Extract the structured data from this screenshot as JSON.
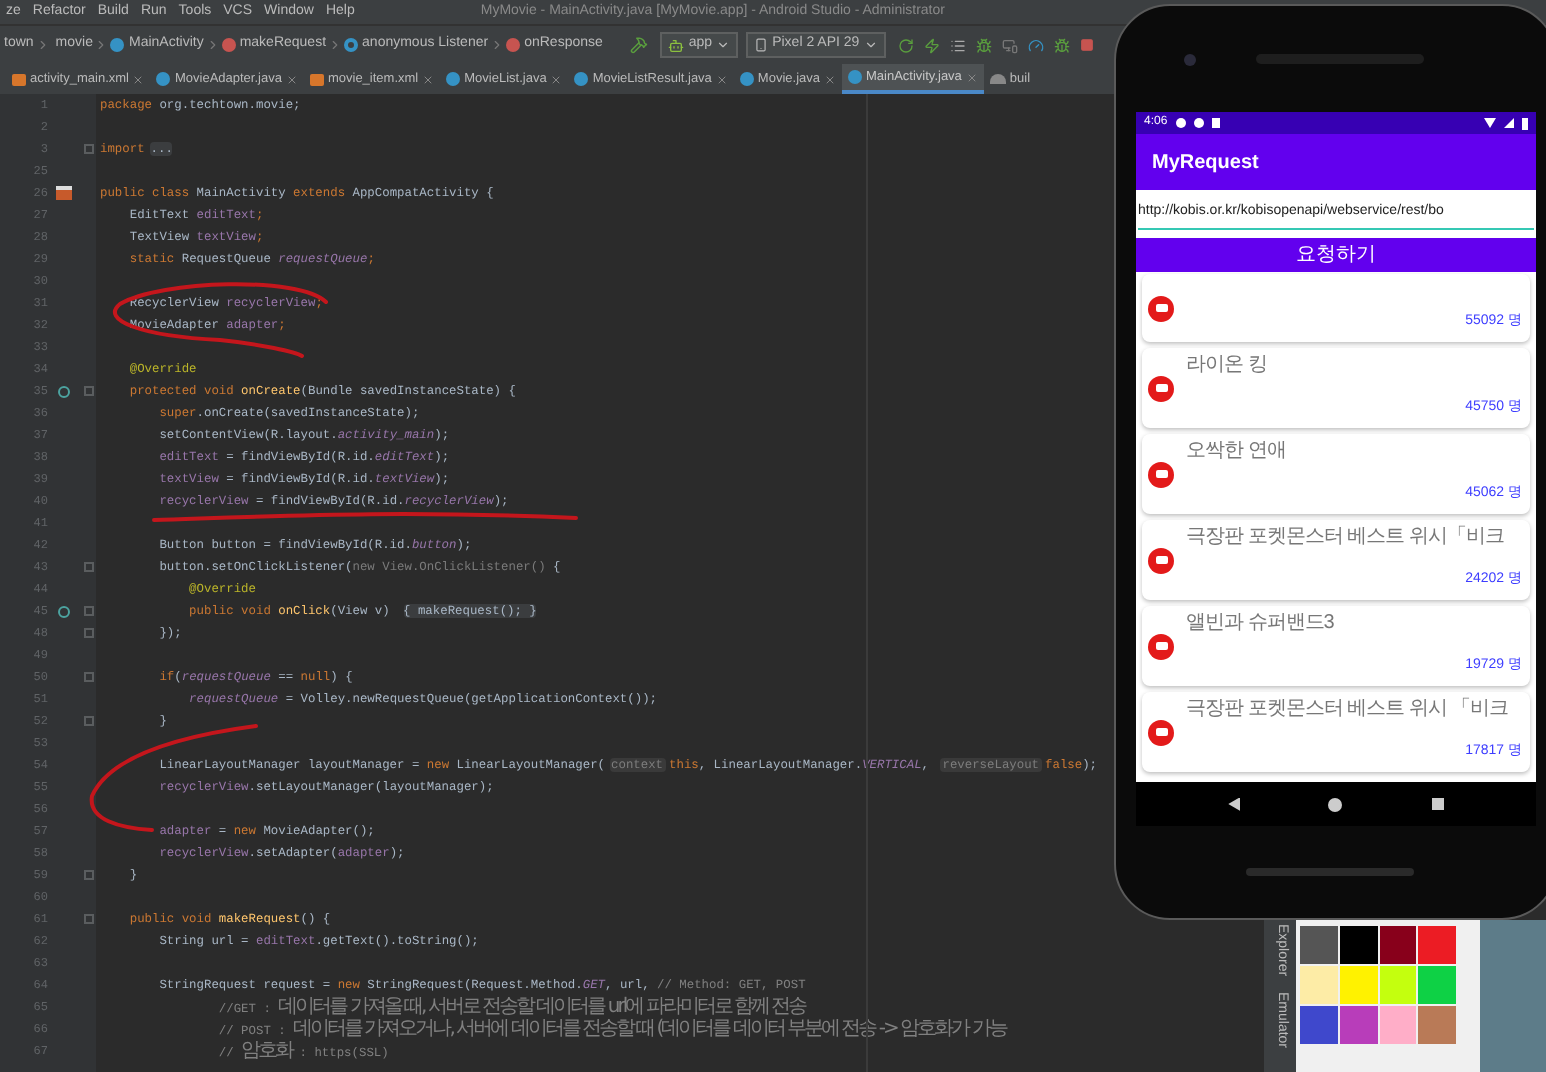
{
  "window": {
    "title": "MyMovie - MainActivity.java [MyMovie.app] - Android Studio - Administrator"
  },
  "menu": [
    "ze",
    "Refactor",
    "Build",
    "Run",
    "Tools",
    "VCS",
    "Window",
    "Help"
  ],
  "breadcrumbs": [
    {
      "label": "town",
      "kind": "folder"
    },
    {
      "label": "movie",
      "kind": "folder"
    },
    {
      "label": "MainActivity",
      "kind": "class"
    },
    {
      "label": "makeRequest",
      "kind": "method"
    },
    {
      "label": "anonymous Listener",
      "kind": "anonymous"
    },
    {
      "label": "onResponse",
      "kind": "method"
    }
  ],
  "run_config": {
    "module": "app",
    "device": "Pixel 2 API 29"
  },
  "tabs": [
    {
      "label": "activity_main.xml",
      "kind": "xml",
      "selected": false
    },
    {
      "label": "MovieAdapter.java",
      "kind": "java",
      "selected": false
    },
    {
      "label": "movie_item.xml",
      "kind": "xml",
      "selected": false
    },
    {
      "label": "MovieList.java",
      "kind": "java",
      "selected": false
    },
    {
      "label": "MovieListResult.java",
      "kind": "java",
      "selected": false
    },
    {
      "label": "Movie.java",
      "kind": "java",
      "selected": false
    },
    {
      "label": "MainActivity.java",
      "kind": "java",
      "selected": true
    },
    {
      "label": "buil",
      "kind": "gradle",
      "selected": false
    }
  ],
  "editor": {
    "lines": [
      {
        "number": "1",
        "fold": false,
        "segments": [
          {
            "kind": "kw",
            "text": "package"
          },
          {
            "kind": "p",
            "text": " org.techtown.movie;"
          }
        ]
      },
      {
        "number": "2",
        "fold": false
      },
      {
        "number": "3",
        "fold": true,
        "segments": [
          {
            "kind": "kw",
            "text": "import"
          },
          {
            "kind": "fold",
            "text": "..."
          }
        ]
      },
      {
        "number": "25",
        "fold": false
      },
      {
        "number": "26",
        "fold": false,
        "kind": "class",
        "segments": [
          {
            "kind": "kw",
            "text": "public class"
          },
          {
            "kind": "p",
            "text": " MainActivity "
          },
          {
            "kind": "kw",
            "text": "extends"
          },
          {
            "kind": "p",
            "text": " AppCompatActivity {"
          }
        ]
      },
      {
        "number": "27",
        "fold": false,
        "segments": [
          {
            "kind": "p",
            "text": "    EditText "
          },
          {
            "kind": "f",
            "text": "editText"
          },
          {
            "kind": "kw",
            "text": ";"
          }
        ]
      },
      {
        "number": "28",
        "fold": false,
        "segments": [
          {
            "kind": "p",
            "text": "    TextView "
          },
          {
            "kind": "f",
            "text": "textView"
          },
          {
            "kind": "kw",
            "text": ";"
          }
        ]
      },
      {
        "number": "29",
        "fold": false,
        "segments": [
          {
            "kind": "kw",
            "text": "    static"
          },
          {
            "kind": "p",
            "text": " RequestQueue "
          },
          {
            "kind": "fi",
            "text": "requestQueue"
          },
          {
            "kind": "kw",
            "text": ";"
          }
        ]
      },
      {
        "number": "30",
        "fold": false
      },
      {
        "number": "31",
        "fold": false,
        "segments": [
          {
            "kind": "p",
            "text": "    RecyclerView "
          },
          {
            "kind": "f",
            "text": "recyclerView"
          },
          {
            "kind": "kw",
            "text": ";"
          }
        ]
      },
      {
        "number": "32",
        "fold": false,
        "segments": [
          {
            "kind": "p",
            "text": "    MovieAdapter "
          },
          {
            "kind": "f",
            "text": "adapter"
          },
          {
            "kind": "kw",
            "text": ";"
          }
        ]
      },
      {
        "number": "33",
        "fold": false
      },
      {
        "number": "34",
        "fold": false,
        "segments": [
          {
            "kind": "a",
            "text": "    @Override"
          }
        ]
      },
      {
        "number": "35",
        "fold": true,
        "kind": "override",
        "segments": [
          {
            "kind": "kw",
            "text": "    protected void"
          },
          {
            "kind": "m",
            "text": " onCreate"
          },
          {
            "kind": "p",
            "text": "(Bundle savedInstanceState) {"
          }
        ]
      },
      {
        "number": "36",
        "fold": false,
        "segments": [
          {
            "kind": "kw",
            "text": "        super"
          },
          {
            "kind": "p",
            "text": ".onCreate(savedInstanceState);"
          }
        ]
      },
      {
        "number": "37",
        "fold": false,
        "segments": [
          {
            "kind": "p",
            "text": "        setContentView(R.layout."
          },
          {
            "kind": "fi",
            "text": "activity_main"
          },
          {
            "kind": "p",
            "text": ");"
          }
        ]
      },
      {
        "number": "38",
        "fold": false,
        "segments": [
          {
            "kind": "f",
            "text": "        editText"
          },
          {
            "kind": "p",
            "text": " = findViewById(R.id."
          },
          {
            "kind": "fi",
            "text": "editText"
          },
          {
            "kind": "p",
            "text": ");"
          }
        ]
      },
      {
        "number": "39",
        "fold": false,
        "segments": [
          {
            "kind": "f",
            "text": "        textView"
          },
          {
            "kind": "p",
            "text": " = findViewById(R.id."
          },
          {
            "kind": "fi",
            "text": "textView"
          },
          {
            "kind": "p",
            "text": ");"
          }
        ]
      },
      {
        "number": "40",
        "fold": false,
        "segments": [
          {
            "kind": "f",
            "text": "        recyclerView"
          },
          {
            "kind": "p",
            "text": " = findViewById(R.id."
          },
          {
            "kind": "fi",
            "text": "recyclerView"
          },
          {
            "kind": "p",
            "text": ");"
          }
        ]
      },
      {
        "number": "41",
        "fold": false
      },
      {
        "number": "42",
        "fold": false,
        "segments": [
          {
            "kind": "p",
            "text": "        Button button = findViewById(R.id."
          },
          {
            "kind": "fi",
            "text": "button"
          },
          {
            "kind": "p",
            "text": ");"
          }
        ]
      },
      {
        "number": "43",
        "fold": true,
        "segments": [
          {
            "kind": "p",
            "text": "        button.setOnClickListener("
          },
          {
            "kind": "dim",
            "text": "new View.OnClickListener()"
          },
          {
            "kind": "p",
            "text": " {"
          }
        ]
      },
      {
        "number": "44",
        "fold": false,
        "segments": [
          {
            "kind": "a",
            "text": "            @Override"
          }
        ]
      },
      {
        "number": "45",
        "fold": true,
        "kind": "override",
        "segments": [
          {
            "kind": "kw",
            "text": "            public void"
          },
          {
            "kind": "m",
            "text": " onClick"
          },
          {
            "kind": "p",
            "text": "(View v) "
          },
          {
            "kind": "fold",
            "text": "{ makeRequest(); }"
          }
        ]
      },
      {
        "number": "48",
        "fold": true,
        "segments": [
          {
            "kind": "p",
            "text": "        });"
          }
        ]
      },
      {
        "number": "49",
        "fold": false
      },
      {
        "number": "50",
        "fold": true,
        "segments": [
          {
            "kind": "kw",
            "text": "        if"
          },
          {
            "kind": "p",
            "text": "("
          },
          {
            "kind": "fi",
            "text": "requestQueue"
          },
          {
            "kind": "p",
            "text": " == "
          },
          {
            "kind": "kw",
            "text": "null"
          },
          {
            "kind": "p",
            "text": ") {"
          }
        ]
      },
      {
        "number": "51",
        "fold": false,
        "segments": [
          {
            "kind": "fi",
            "text": "            requestQueue"
          },
          {
            "kind": "p",
            "text": " = Volley.newRequestQueue(getApplicationContext());"
          }
        ]
      },
      {
        "number": "52",
        "fold": true,
        "segments": [
          {
            "kind": "p",
            "text": "        }"
          }
        ]
      },
      {
        "number": "53",
        "fold": false
      },
      {
        "number": "54",
        "fold": false,
        "segments": [
          {
            "kind": "p",
            "text": "        LinearLayoutManager layoutManager = "
          },
          {
            "kind": "kw",
            "text": "new"
          },
          {
            "kind": "p",
            "text": " LinearLayoutManager("
          },
          {
            "kind": "h",
            "text": "context"
          },
          {
            "kind": "kw",
            "text": "this"
          },
          {
            "kind": "p",
            "text": ", LinearLayoutManager."
          },
          {
            "kind": "fi",
            "text": "VERTICAL"
          },
          {
            "kind": "p",
            "text": ", "
          },
          {
            "kind": "h",
            "text": "reverseLayout"
          },
          {
            "kind": "kw",
            "text": "false"
          },
          {
            "kind": "p",
            "text": ");"
          }
        ]
      },
      {
        "number": "55",
        "fold": false,
        "segments": [
          {
            "kind": "f",
            "text": "        recyclerView"
          },
          {
            "kind": "p",
            "text": ".setLayoutManager(layoutManager);"
          }
        ]
      },
      {
        "number": "56",
        "fold": false
      },
      {
        "number": "57",
        "fold": false,
        "segments": [
          {
            "kind": "f",
            "text": "        adapter"
          },
          {
            "kind": "p",
            "text": " = "
          },
          {
            "kind": "kw",
            "text": "new"
          },
          {
            "kind": "p",
            "text": " MovieAdapter();"
          }
        ]
      },
      {
        "number": "58",
        "fold": false,
        "segments": [
          {
            "kind": "f",
            "text": "        recyclerView"
          },
          {
            "kind": "p",
            "text": ".setAdapter("
          },
          {
            "kind": "f",
            "text": "adapter"
          },
          {
            "kind": "p",
            "text": ");"
          }
        ]
      },
      {
        "number": "59",
        "fold": true,
        "segments": [
          {
            "kind": "p",
            "text": "    }"
          }
        ]
      },
      {
        "number": "60",
        "fold": false
      },
      {
        "number": "61",
        "fold": true,
        "segments": [
          {
            "kind": "kw",
            "text": "    public void"
          },
          {
            "kind": "m",
            "text": " makeRequest"
          },
          {
            "kind": "p",
            "text": "() {"
          }
        ]
      },
      {
        "number": "62",
        "fold": false,
        "segments": [
          {
            "kind": "p",
            "text": "        String url = "
          },
          {
            "kind": "f",
            "text": "editText"
          },
          {
            "kind": "p",
            "text": ".getText().toString();"
          }
        ]
      },
      {
        "number": "63",
        "fold": false
      },
      {
        "number": "64",
        "fold": false,
        "segments": [
          {
            "kind": "p",
            "text": "        StringRequest request = "
          },
          {
            "kind": "kw",
            "text": "new"
          },
          {
            "kind": "p",
            "text": " StringRequest(Request.Method."
          },
          {
            "kind": "fi",
            "text": "GET"
          },
          {
            "kind": "p",
            "text": ", url, "
          },
          {
            "kind": "c",
            "text": "// Method: GET, POST"
          }
        ]
      },
      {
        "number": "65",
        "fold": false,
        "segments": [
          {
            "kind": "c",
            "text": "                //GET : "
          },
          {
            "kind": "ko",
            "text": "데이터를 가져올 때, 서버로 전송할 데이터를 url에 파라미터로 함께 전송"
          }
        ]
      },
      {
        "number": "66",
        "fold": false,
        "segments": [
          {
            "kind": "c",
            "text": "                // POST : "
          },
          {
            "kind": "ko",
            "text": "데이터를 가져오거나, 서버에 데이터를 전송할 때 (데이터를 데이터 부분에 전송 -> 암호화가 가능"
          }
        ]
      },
      {
        "number": "67",
        "fold": false,
        "segments": [
          {
            "kind": "c",
            "text": "                // "
          },
          {
            "kind": "ko",
            "text": "암호화"
          },
          {
            "kind": "c",
            "text": " : https(SSL)"
          }
        ]
      }
    ]
  },
  "phone": {
    "status_time": "4:06",
    "app_title": "MyRequest",
    "url_value": "http://kobis.or.kr/kobisopenapi/webservice/rest/bo",
    "button_label": "요청하기",
    "movies": [
      {
        "count": "55092 명"
      },
      {
        "title": "라이온 킹",
        "count": "45750 명"
      },
      {
        "title": "오싹한 연애",
        "count": "45062 명"
      },
      {
        "title": "극장판 포켓몬스터 베스트 위시「비크",
        "count": "24202 명"
      },
      {
        "title": "앨빈과 슈퍼밴드3",
        "count": "19729 명"
      },
      {
        "title": "극장판 포켓몬스터 베스트 위시 「비크",
        "count": "17817 명"
      }
    ]
  },
  "tool_strip": [
    "Explorer",
    "Emulator"
  ],
  "palette": [
    {
      "color": "#555555"
    },
    {
      "color": "#000000"
    },
    {
      "color": "#88001b"
    },
    {
      "color": "#ec1c24"
    },
    {
      "color": "#fdeca6"
    },
    {
      "color": "#fff200"
    },
    {
      "color": "#c4ff0e"
    },
    {
      "color": "#0ed145"
    },
    {
      "color": "#3f48cc"
    },
    {
      "color": "#b83dba"
    },
    {
      "color": "#ffaec8"
    },
    {
      "color": "#b97a57"
    }
  ]
}
